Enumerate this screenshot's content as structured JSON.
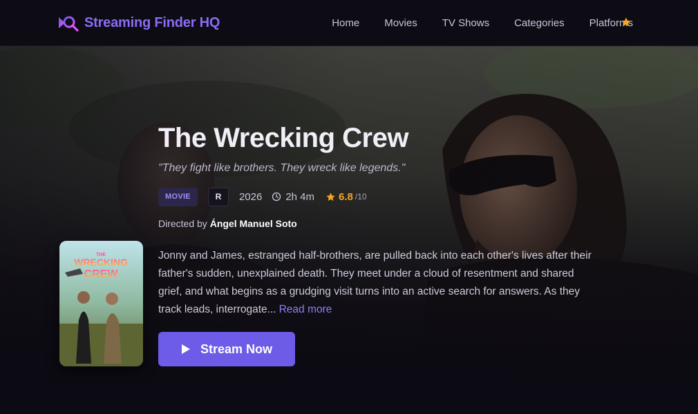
{
  "header": {
    "brand_name": "Streaming Finder HQ",
    "nav": [
      "Home",
      "Movies",
      "TV Shows",
      "Categories",
      "Platforms"
    ],
    "favorites_icon": "star-icon"
  },
  "movie": {
    "title": "The Wrecking Crew",
    "tagline": "\"They fight like brothers. They wreck like legends.\"",
    "type_badge": "MOVIE",
    "rating_badge": "R",
    "year": "2026",
    "runtime": "2h 4m",
    "score": "6.8",
    "score_max": "/10",
    "directed_label": "Directed by",
    "director": "Ángel Manuel Soto",
    "synopsis": "Jonny and James, estranged half-brothers, are pulled back into each other's lives after their father's sudden, unexplained death. They meet under a cloud of resentment and shared grief, and what begins as a grudging visit turns into an active search for answers. As they track leads, interrogate...",
    "read_more": "Read more",
    "stream_button": "Stream Now"
  },
  "poster": {
    "title_line1": "THE",
    "title_line2": "WRECKING",
    "title_line3": "CREW"
  },
  "colors": {
    "accent": "#6c5ce7",
    "brand": "#8b6cf6",
    "score": "#f5a623",
    "background": "#0c0a12"
  }
}
